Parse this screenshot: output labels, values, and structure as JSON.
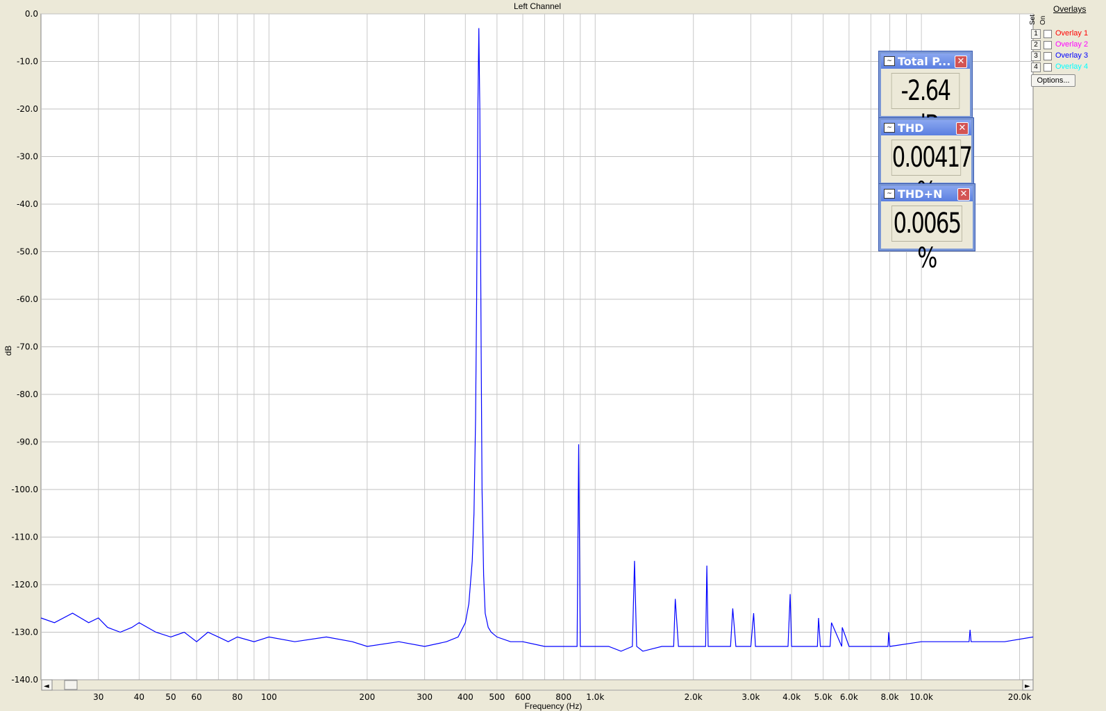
{
  "chart_data": {
    "type": "line",
    "title": "Left Channel",
    "xlabel": "Frequency (Hz)",
    "ylabel": "dB",
    "xscale": "log",
    "xlim": [
      20,
      22000
    ],
    "ylim": [
      -140,
      0
    ],
    "y_ticks": [
      "0.0",
      "-10.0",
      "-20.0",
      "-30.0",
      "-40.0",
      "-50.0",
      "-60.0",
      "-70.0",
      "-80.0",
      "-90.0",
      "-100.0",
      "-110.0",
      "-120.0",
      "-130.0",
      "-140.0"
    ],
    "x_ticks": [
      {
        "v": 30,
        "label": "30"
      },
      {
        "v": 40,
        "label": "40"
      },
      {
        "v": 50,
        "label": "50"
      },
      {
        "v": 60,
        "label": "60"
      },
      {
        "v": 80,
        "label": "80"
      },
      {
        "v": 100,
        "label": "100"
      },
      {
        "v": 200,
        "label": "200"
      },
      {
        "v": 300,
        "label": "300"
      },
      {
        "v": 400,
        "label": "400"
      },
      {
        "v": 500,
        "label": "500"
      },
      {
        "v": 600,
        "label": "600"
      },
      {
        "v": 800,
        "label": "800"
      },
      {
        "v": 1000,
        "label": "1.0k"
      },
      {
        "v": 2000,
        "label": "2.0k"
      },
      {
        "v": 3000,
        "label": "3.0k"
      },
      {
        "v": 4000,
        "label": "4.0k"
      },
      {
        "v": 5000,
        "label": "5.0k"
      },
      {
        "v": 6000,
        "label": "6.0k"
      },
      {
        "v": 8000,
        "label": "8.0k"
      },
      {
        "v": 10000,
        "label": "10.0k"
      },
      {
        "v": 20000,
        "label": "20.0k"
      }
    ],
    "grid": true,
    "series": [
      {
        "color": "#0000ff",
        "x": [
          20,
          22,
          25,
          28,
          30,
          32,
          35,
          38,
          40,
          45,
          50,
          55,
          60,
          65,
          70,
          75,
          80,
          90,
          100,
          120,
          150,
          180,
          200,
          250,
          300,
          350,
          380,
          400,
          410,
          420,
          425,
          430,
          433,
          437,
          440,
          443,
          447,
          450,
          455,
          460,
          470,
          480,
          500,
          550,
          600,
          700,
          800,
          850,
          880,
          890,
          900,
          950,
          1000,
          1100,
          1200,
          1300,
          1320,
          1340,
          1400,
          1600,
          1740,
          1760,
          1800,
          2000,
          2180,
          2200,
          2220,
          2400,
          2600,
          2640,
          2700,
          3000,
          3060,
          3100,
          3500,
          3900,
          3960,
          4000,
          4500,
          4800,
          4840,
          4900,
          5250,
          5300,
          5700,
          5720,
          6000,
          7000,
          7900,
          7940,
          8000,
          10000,
          14000,
          14100,
          14200,
          18000,
          22000
        ],
        "y": [
          -127,
          -128,
          -126,
          -128,
          -127,
          -129,
          -130,
          -129,
          -128,
          -130,
          -131,
          -130,
          -132,
          -130,
          -131,
          -132,
          -131,
          -132,
          -131,
          -132,
          -131,
          -132,
          -133,
          -132,
          -133,
          -132,
          -131,
          -128,
          -124,
          -115,
          -105,
          -85,
          -60,
          -20,
          -3,
          -20,
          -70,
          -100,
          -118,
          -126,
          -129,
          -130,
          -131,
          -132,
          -132,
          -133,
          -133,
          -133,
          -133,
          -90.5,
          -133,
          -133,
          -133,
          -133,
          -134,
          -133,
          -115,
          -133,
          -134,
          -133,
          -133,
          -123,
          -133,
          -133,
          -133,
          -116,
          -133,
          -133,
          -133,
          -125,
          -133,
          -133,
          -126,
          -133,
          -133,
          -133,
          -122,
          -133,
          -133,
          -133,
          -127,
          -133,
          -133,
          -128,
          -133,
          -129,
          -133,
          -133,
          -133,
          -130,
          -133,
          -132,
          -132,
          -129.5,
          -132,
          -132,
          -131
        ]
      }
    ]
  },
  "overlays": {
    "title": "Overlays",
    "hdr_set": "Set",
    "hdr_on": "On",
    "items": [
      {
        "set": "1",
        "label": "Overlay 1",
        "color": "#ff0000"
      },
      {
        "set": "2",
        "label": "Overlay 2",
        "color": "#ff00ff"
      },
      {
        "set": "3",
        "label": "Overlay 3",
        "color": "#0000ff"
      },
      {
        "set": "4",
        "label": "Overlay 4",
        "color": "#00ffff"
      }
    ],
    "options_label": "Options..."
  },
  "meters": [
    {
      "title": "Total P...",
      "value": "-2.64 dB"
    },
    {
      "title": "THD",
      "value": "0.00417 %"
    },
    {
      "title": "THD+N",
      "value": "0.0065 %"
    }
  ],
  "scrollbar": {
    "left_arrow": "◄",
    "right_arrow": "►"
  },
  "colors": {
    "plot_bg": "#ffffff",
    "grid": "#c0c0c0",
    "trace": "#0000ff",
    "frame_bg": "#ece9d8"
  }
}
